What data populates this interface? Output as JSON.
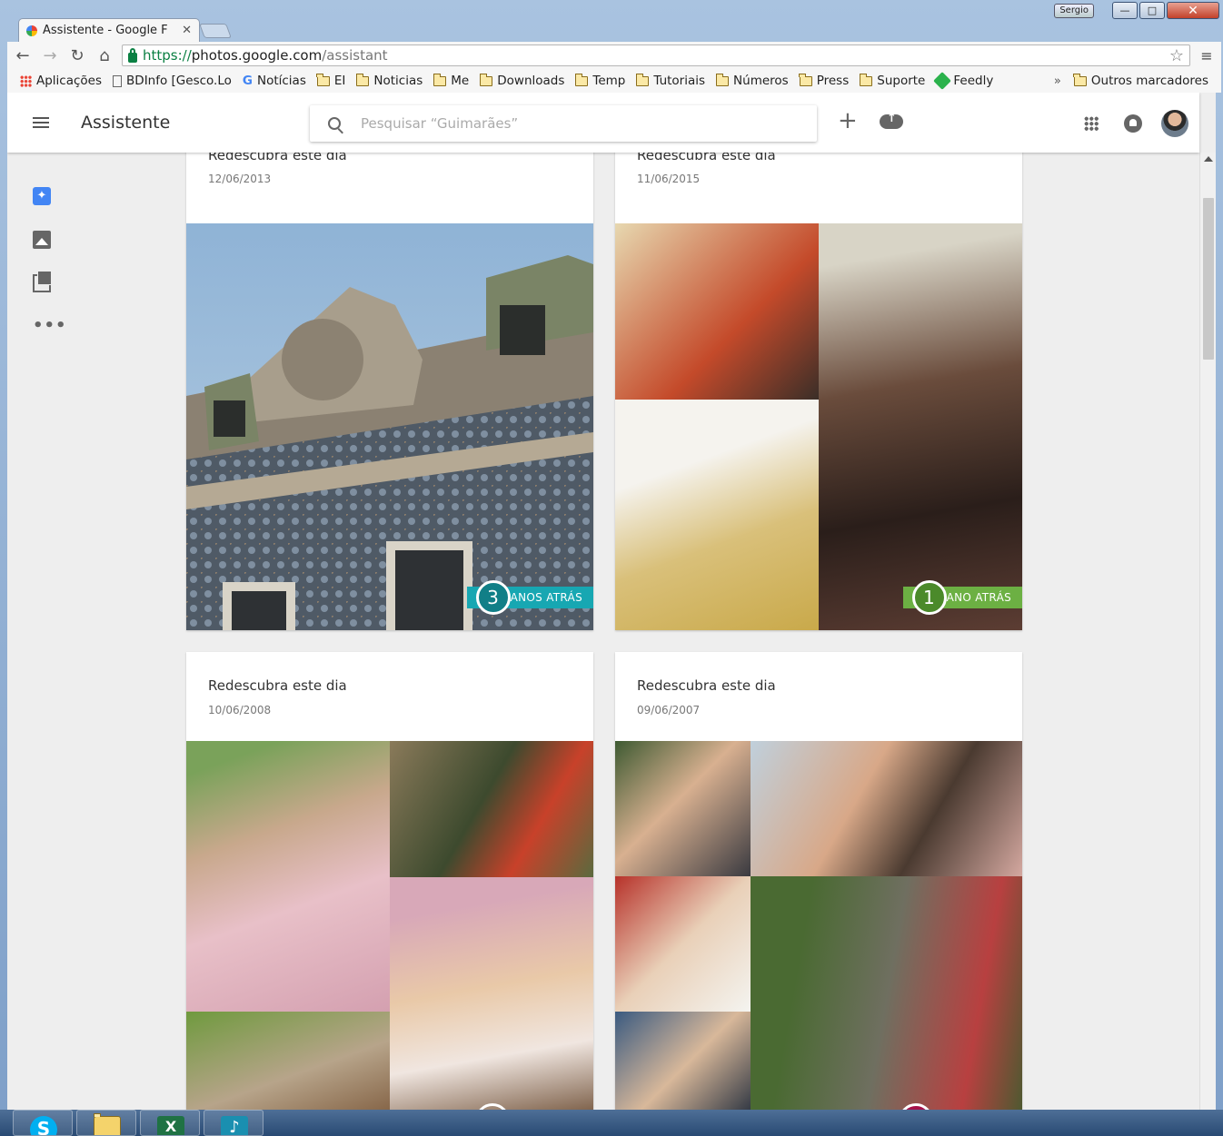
{
  "window": {
    "user_tag": "Sergio",
    "minimize": "—",
    "maximize": "□",
    "close": "✕"
  },
  "tab": {
    "title": "Assistente - Google F",
    "close": "✕"
  },
  "address": {
    "scheme": "https://",
    "host": "photos.google.com",
    "path": "/assistant"
  },
  "bookmarks": {
    "items": [
      {
        "label": "Aplicações",
        "icon": "apps-icon"
      },
      {
        "label": "BDInfo [Gesco.Lo",
        "icon": "page-icon"
      },
      {
        "label": "Notícias",
        "icon": "google-icon"
      },
      {
        "label": "EI",
        "icon": "folder-icon"
      },
      {
        "label": "Noticias",
        "icon": "folder-icon"
      },
      {
        "label": "Me",
        "icon": "folder-icon"
      },
      {
        "label": "Downloads",
        "icon": "folder-icon"
      },
      {
        "label": "Temp",
        "icon": "folder-icon"
      },
      {
        "label": "Tutoriais",
        "icon": "folder-icon"
      },
      {
        "label": "Números",
        "icon": "folder-icon"
      },
      {
        "label": "Press",
        "icon": "folder-icon"
      },
      {
        "label": "Suporte",
        "icon": "folder-icon"
      },
      {
        "label": "Feedly",
        "icon": "feedly-icon"
      }
    ],
    "overflow": "»",
    "other": "Outros marcadores"
  },
  "app": {
    "title": "Assistente",
    "search_placeholder": "Pesquisar “Guimarães”",
    "plus": "+"
  },
  "sidenav": {
    "more": "•••"
  },
  "cards": [
    {
      "title": "Redescubra este dia",
      "date": "12/06/2013",
      "badge_num": "3",
      "badge_label": "ANOS ATRÁS"
    },
    {
      "title": "Redescubra este dia",
      "date": "11/06/2015",
      "badge_num": "1",
      "badge_label": "ANO ATRÁS"
    },
    {
      "title": "Redescubra este dia",
      "date": "10/06/2008"
    },
    {
      "title": "Redescubra este dia",
      "date": "09/06/2007"
    }
  ],
  "colors": {
    "accent_blue": "#4285f4",
    "badge_teal": "#17a7b2",
    "badge_green": "#6cb043",
    "badge_pink": "#d81b60"
  }
}
